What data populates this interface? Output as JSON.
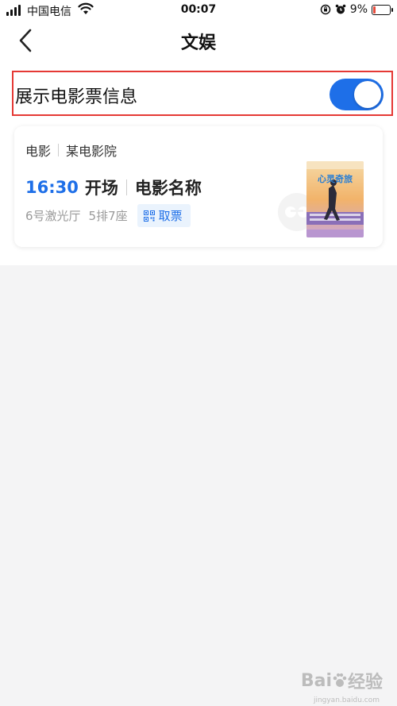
{
  "status_bar": {
    "carrier": "中国电信",
    "time": "00:07",
    "battery": "9%"
  },
  "nav": {
    "title": "文娱"
  },
  "setting": {
    "label": "展示电影票信息",
    "toggle_on": true
  },
  "card": {
    "category": "电影",
    "cinema": "某电影院",
    "show_time": "16:30",
    "start_label": "开场",
    "movie_name": "电影名称",
    "hall": "6号激光厅",
    "seat": "5排7座",
    "ticket_button": "取票",
    "poster_title": "心灵奇旅"
  },
  "watermark": {
    "brand": "Bai",
    "brand2": "经验",
    "sub": "jingyan.baidu.com"
  },
  "colors": {
    "accent": "#1e6fe8",
    "highlight_border": "#e53935",
    "background": "#f4f4f5"
  },
  "icons": [
    "signal-icon",
    "wifi-icon",
    "rotation-lock-icon",
    "alarm-icon",
    "battery-icon",
    "back-chevron-icon",
    "qr-code-icon"
  ]
}
